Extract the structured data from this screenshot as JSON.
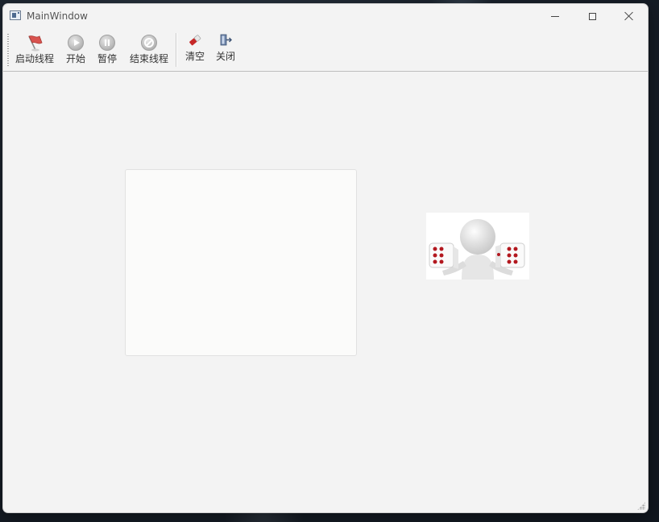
{
  "window": {
    "title": "MainWindow"
  },
  "toolbar": {
    "buttons": [
      {
        "label": "启动线程",
        "icon": "red-flag-icon"
      },
      {
        "label": "开始",
        "icon": "play-icon"
      },
      {
        "label": "暂停",
        "icon": "pause-icon"
      },
      {
        "label": "结束线程",
        "icon": "stop-icon"
      },
      {
        "label": "清空",
        "icon": "eraser-icon"
      },
      {
        "label": "关闭",
        "icon": "exit-door-icon"
      }
    ]
  },
  "content": {
    "picture_icon": "figure-with-dice-image"
  },
  "colors": {
    "window_bg": "#f3f3f3",
    "panel_bg": "#fbfbfa",
    "flag_red": "#d9534f",
    "dice_red": "#b3181f"
  }
}
